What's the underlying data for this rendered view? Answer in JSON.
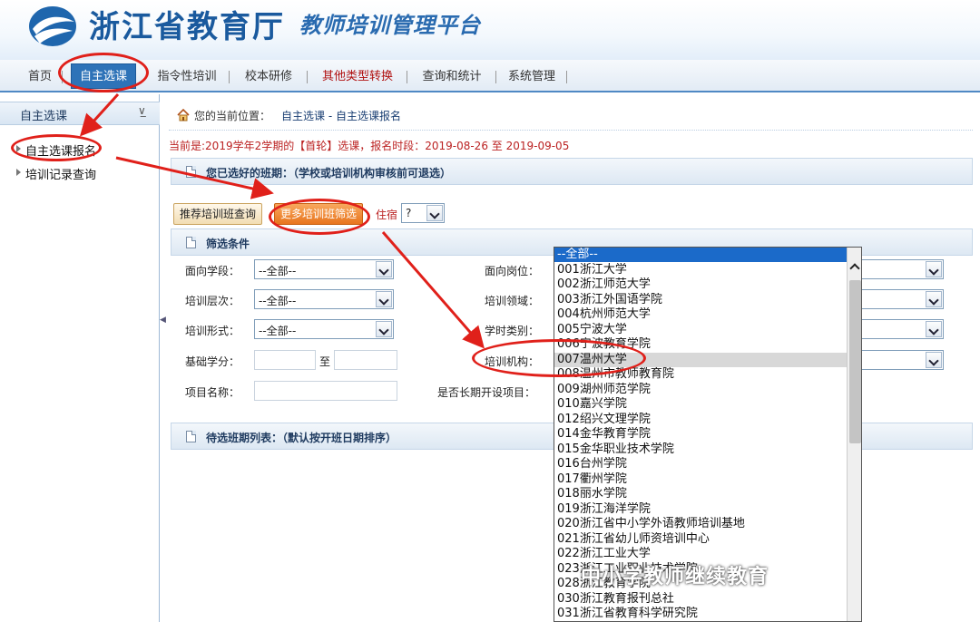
{
  "header": {
    "org_name": "浙江省教育厅",
    "platform_name": "教师培训管理平台"
  },
  "nav": {
    "items": [
      {
        "label": "首页"
      },
      {
        "label": "自主选课",
        "active": true
      },
      {
        "label": "指令性培训"
      },
      {
        "label": "校本研修"
      },
      {
        "label": "其他类型转换"
      },
      {
        "label": "查询和统计"
      },
      {
        "label": "系统管理"
      }
    ]
  },
  "sidebar": {
    "title": "自主选课",
    "collapse_icon": "double-chevron-down-icon",
    "items": [
      {
        "label": "自主选课报名"
      },
      {
        "label": "培训记录查询"
      }
    ]
  },
  "breadcrumb": {
    "label": "您的当前位置：",
    "path": "自主选课 - 自主选课报名"
  },
  "notice": {
    "text": "当前是:2019学年2学期的【首轮】选课，报名时段：2019-08-26 至 2019-09-05"
  },
  "selected_section": {
    "title": "您已选好的班期：（学校或培训机构审核前可退选）"
  },
  "buttons": {
    "recommend": "推荐培训班查询",
    "more_filter": "更多培训班筛选"
  },
  "lodging": {
    "label": "住宿",
    "value": "?"
  },
  "filter_section": {
    "title": "筛选条件",
    "fields": {
      "target_stage": {
        "label": "面向学段：",
        "value": "--全部--"
      },
      "target_post": {
        "label": "面向岗位："
      },
      "training_level": {
        "label": "培训层次：",
        "value": "--全部--"
      },
      "training_field": {
        "label": "培训领域："
      },
      "training_form": {
        "label": "培训形式：",
        "value": "--全部--"
      },
      "hour_type": {
        "label": "学时类别："
      },
      "base_credit": {
        "label": "基础学分：",
        "to": "至"
      },
      "training_org": {
        "label": "培训机构："
      },
      "project_name": {
        "label": "项目名称："
      },
      "long_term": {
        "label": "是否长期开设项目："
      }
    }
  },
  "pending_section": {
    "title": "待选班期列表：（默认按开班日期排序）"
  },
  "org_dropdown": {
    "options": [
      "--全部--",
      "001浙江大学",
      "002浙江师范大学",
      "003浙江外国语学院",
      "004杭州师范大学",
      "005宁波大学",
      "006宁波教育学院",
      "007温州大学",
      "008温州市教师教育院",
      "009湖州师范学院",
      "010嘉兴学院",
      "012绍兴文理学院",
      "014金华教育学院",
      "015金华职业技术学院",
      "016台州学院",
      "017衢州学院",
      "018丽水学院",
      "019浙江海洋学院",
      "020浙江省中小学外语教师培训基地",
      "021浙江省幼儿师资培训中心",
      "022浙江工业大学",
      "023浙江工业职业技术学院",
      "028浙江教育学院",
      "030浙江教育报刊总社",
      "031浙江省教育科学研究院"
    ],
    "selected_index": 0,
    "highlighted_index": 7
  },
  "watermark": {
    "text": "中小学教师继续教育"
  }
}
